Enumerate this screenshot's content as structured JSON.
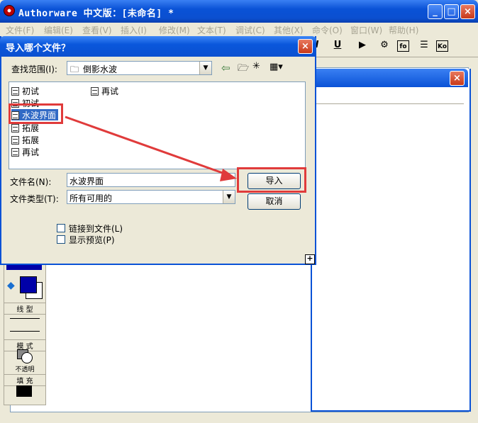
{
  "app": {
    "title": "Authorware 中文版：[未命名] *"
  },
  "menu": [
    "文件(F)",
    "编辑(E)",
    "查看(V)",
    "插入(I)",
    "修改(M)",
    "文本(T)",
    "调试(C)",
    "其他(X)",
    "命令(O)",
    "窗口(W)",
    "帮助(H)"
  ],
  "toolbar": {
    "underline": "U",
    "fo": "fo",
    "ko": "Ko"
  },
  "palette": {
    "line_label": "线 型",
    "mode_label": "模 式",
    "mode_value": "不透明",
    "fill_label": "填 充"
  },
  "dialog": {
    "title": "导入哪个文件？",
    "look_in_label": "查找范围(I):",
    "look_in_value": "倒影水波",
    "files": [
      "初试",
      "初试",
      "水波界面",
      "拓展",
      "拓展",
      "再试",
      "再试"
    ],
    "selected_file": "水波界面",
    "filename_label": "文件名(N):",
    "filename_value": "水波界面",
    "filetype_label": "文件类型(T):",
    "filetype_value": "所有可用的",
    "import_button": "导入",
    "cancel_button": "取消",
    "link_checkbox": "链接到文件(L)",
    "preview_checkbox": "显示预览(P)",
    "plus_glyph": "+"
  },
  "colors": {
    "title_blue": "#0a52d6",
    "highlight": "#e03b3b",
    "selection": "#316ac5",
    "palette_fill": "#0000a8"
  }
}
